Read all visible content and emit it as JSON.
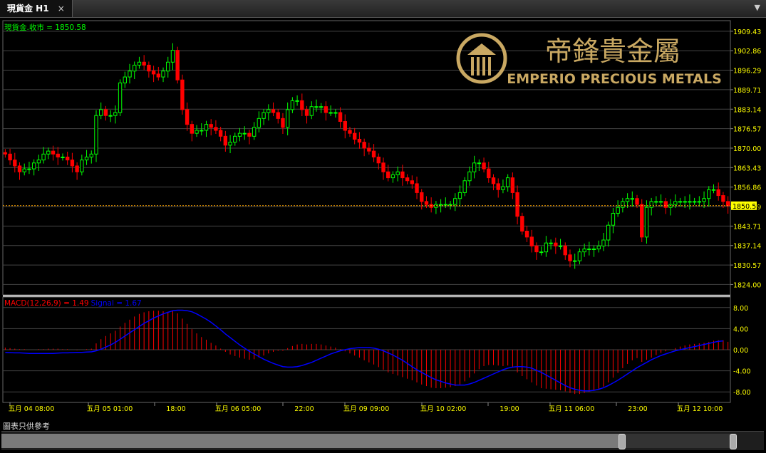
{
  "window": {
    "tab_title": "現貨金 H1",
    "close_glyph": "×"
  },
  "colors": {
    "up": "#00ff00",
    "down": "#ff0000",
    "grid": "#444444",
    "axis_text": "#ffff00",
    "macd_line": "#0000ff",
    "price_line": "#ffa500",
    "gold": "#c9a862"
  },
  "brand": {
    "name_cn": "帝鋒貴金屬",
    "name_en": "EMPERIO PRECIOUS METALS"
  },
  "footer": {
    "disclaimer": "圖表只供參考"
  },
  "chart_data": [
    {
      "type": "candlestick",
      "legend_text": "現貨金.收市 = 1850.58",
      "last_price_label": "1850.58",
      "last_price": 1850.58,
      "ylim": [
        1820.5,
        1913
      ],
      "yticks": [
        1824.0,
        1830.57,
        1837.14,
        1843.71,
        1850.29,
        1856.86,
        1863.43,
        1870.0,
        1876.57,
        1883.14,
        1889.71,
        1896.29,
        1902.86,
        1909.43
      ],
      "ytick_labels": [
        "1824.00",
        "1830.57",
        "1837.14",
        "1843.71",
        "1850.29",
        "1856.86",
        "1863.43",
        "1870.00",
        "1876.57",
        "1883.14",
        "1889.71",
        "1896.29",
        "1902.86",
        "1909.43"
      ],
      "xtick_labels": [
        "五月 04 08:00",
        "五月 05 01:00",
        "18:00",
        "五月 06 05:00",
        "22:00",
        "五月 09 09:00",
        "五月 10 02:00",
        "19:00",
        "五月 11 06:00",
        "23:00",
        "五月 12 10:00"
      ],
      "closes": [
        1868,
        1866,
        1864,
        1862,
        1863,
        1863,
        1865,
        1866,
        1868,
        1869,
        1868,
        1867,
        1867,
        1866,
        1864,
        1862,
        1866,
        1867,
        1868,
        1881,
        1883,
        1881,
        1881,
        1882,
        1892,
        1894,
        1896,
        1898,
        1899,
        1898,
        1896,
        1895,
        1894,
        1896,
        1899,
        1903,
        1893,
        1883,
        1878,
        1875,
        1876,
        1876,
        1878,
        1877,
        1876,
        1874,
        1871,
        1872,
        1874,
        1875,
        1875,
        1874,
        1877,
        1880,
        1882,
        1883,
        1882,
        1880,
        1877,
        1883,
        1886,
        1886,
        1883,
        1881,
        1884,
        1884,
        1884,
        1882,
        1882,
        1882,
        1879,
        1876,
        1875,
        1873,
        1872,
        1870,
        1869,
        1867,
        1865,
        1862,
        1860,
        1861,
        1862,
        1860,
        1859,
        1858,
        1855,
        1852,
        1851,
        1850,
        1851,
        1851,
        1851,
        1851,
        1853,
        1855,
        1859,
        1862,
        1865,
        1865,
        1863,
        1860,
        1858,
        1856,
        1857,
        1860,
        1855,
        1847,
        1842,
        1840,
        1837,
        1835,
        1835,
        1838,
        1838,
        1837,
        1837,
        1834,
        1832,
        1832,
        1835,
        1836,
        1836,
        1836,
        1837,
        1839,
        1844,
        1848,
        1850,
        1852,
        1853,
        1853,
        1851,
        1840,
        1850,
        1852,
        1852,
        1852,
        1850,
        1851,
        1852,
        1852,
        1852,
        1852,
        1852,
        1852,
        1853,
        1856,
        1856,
        1854,
        1852,
        1850.58
      ],
      "macd": {
        "legend_text": "MACD(12,26,9) = 1.49",
        "signal_text": "Signal = 1.67",
        "value": 1.49,
        "signal": 1.67,
        "ylim": [
          -10,
          10
        ],
        "yticks": [
          -8,
          -4,
          0,
          4,
          8
        ],
        "ytick_labels": [
          "-8.00",
          "-4.00",
          "0.00",
          "4.00",
          "8.00"
        ],
        "hist": [
          0.4,
          0.3,
          0.2,
          0.1,
          0.1,
          0.0,
          0.0,
          0.1,
          0.1,
          0.2,
          0.2,
          0.2,
          0.1,
          0.1,
          0.0,
          -0.1,
          0.0,
          0.1,
          0.2,
          1.2,
          2.0,
          2.6,
          3.1,
          3.6,
          4.4,
          5.1,
          5.7,
          6.3,
          6.8,
          7.1,
          7.3,
          7.4,
          7.4,
          7.3,
          7.2,
          7.5,
          6.9,
          5.9,
          4.9,
          3.9,
          3.1,
          2.4,
          1.9,
          1.3,
          0.8,
          0.2,
          -0.4,
          -0.9,
          -1.2,
          -1.5,
          -1.7,
          -1.9,
          -1.8,
          -1.5,
          -1.1,
          -0.7,
          -0.4,
          -0.2,
          -0.2,
          0.3,
          0.7,
          1.0,
          1.1,
          1.0,
          1.1,
          1.1,
          1.0,
          0.8,
          0.6,
          0.4,
          0.1,
          -0.3,
          -0.7,
          -1.1,
          -1.5,
          -2.0,
          -2.4,
          -2.8,
          -3.3,
          -3.8,
          -4.3,
          -4.6,
          -4.9,
          -5.2,
          -5.5,
          -5.8,
          -6.2,
          -6.6,
          -6.9,
          -7.2,
          -7.3,
          -7.3,
          -7.2,
          -7.1,
          -6.9,
          -6.6,
          -6.0,
          -5.3,
          -4.5,
          -3.7,
          -3.1,
          -2.9,
          -2.9,
          -3.0,
          -3.1,
          -3.0,
          -3.4,
          -4.3,
          -5.0,
          -5.6,
          -6.2,
          -6.8,
          -7.3,
          -7.4,
          -7.5,
          -7.6,
          -7.7,
          -7.9,
          -8.2,
          -8.4,
          -8.4,
          -8.2,
          -8.0,
          -7.7,
          -7.4,
          -7.0,
          -6.2,
          -5.3,
          -4.4,
          -3.5,
          -2.7,
          -2.0,
          -1.6,
          -2.3,
          -1.9,
          -1.5,
          -1.0,
          -0.6,
          -0.3,
          0.0,
          0.3,
          0.6,
          0.8,
          1.0,
          1.1,
          1.2,
          1.3,
          1.5,
          1.7,
          1.8,
          1.8,
          1.5
        ],
        "signal_line": [
          -0.5,
          -0.55,
          -0.6,
          -0.6,
          -0.65,
          -0.7,
          -0.7,
          -0.7,
          -0.7,
          -0.7,
          -0.7,
          -0.65,
          -0.6,
          -0.6,
          -0.55,
          -0.5,
          -0.5,
          -0.45,
          -0.4,
          -0.2,
          0.1,
          0.5,
          0.9,
          1.4,
          2.0,
          2.6,
          3.2,
          3.8,
          4.4,
          5.0,
          5.5,
          6.0,
          6.4,
          6.8,
          7.1,
          7.4,
          7.5,
          7.5,
          7.4,
          7.2,
          6.8,
          6.3,
          5.8,
          5.2,
          4.5,
          3.8,
          3.0,
          2.3,
          1.6,
          0.9,
          0.3,
          -0.3,
          -0.8,
          -1.3,
          -1.8,
          -2.2,
          -2.6,
          -2.9,
          -3.2,
          -3.3,
          -3.3,
          -3.2,
          -3.0,
          -2.7,
          -2.4,
          -2.0,
          -1.6,
          -1.2,
          -0.8,
          -0.5,
          -0.2,
          0.0,
          0.2,
          0.3,
          0.4,
          0.4,
          0.4,
          0.3,
          0.1,
          -0.2,
          -0.6,
          -1.0,
          -1.5,
          -2.0,
          -2.6,
          -3.2,
          -3.8,
          -4.3,
          -4.8,
          -5.3,
          -5.7,
          -6.0,
          -6.3,
          -6.5,
          -6.7,
          -6.7,
          -6.7,
          -6.5,
          -6.2,
          -5.8,
          -5.4,
          -5.0,
          -4.6,
          -4.2,
          -3.8,
          -3.5,
          -3.3,
          -3.2,
          -3.2,
          -3.3,
          -3.5,
          -3.9,
          -4.3,
          -4.8,
          -5.3,
          -5.8,
          -6.3,
          -6.8,
          -7.2,
          -7.5,
          -7.7,
          -7.8,
          -7.8,
          -7.7,
          -7.5,
          -7.2,
          -6.8,
          -6.3,
          -5.8,
          -5.2,
          -4.6,
          -4.0,
          -3.4,
          -2.9,
          -2.4,
          -1.9,
          -1.5,
          -1.1,
          -0.8,
          -0.5,
          -0.2,
          0.0,
          0.2,
          0.4,
          0.6,
          0.8,
          1.0,
          1.2,
          1.4,
          1.6,
          1.67
        ]
      }
    }
  ]
}
